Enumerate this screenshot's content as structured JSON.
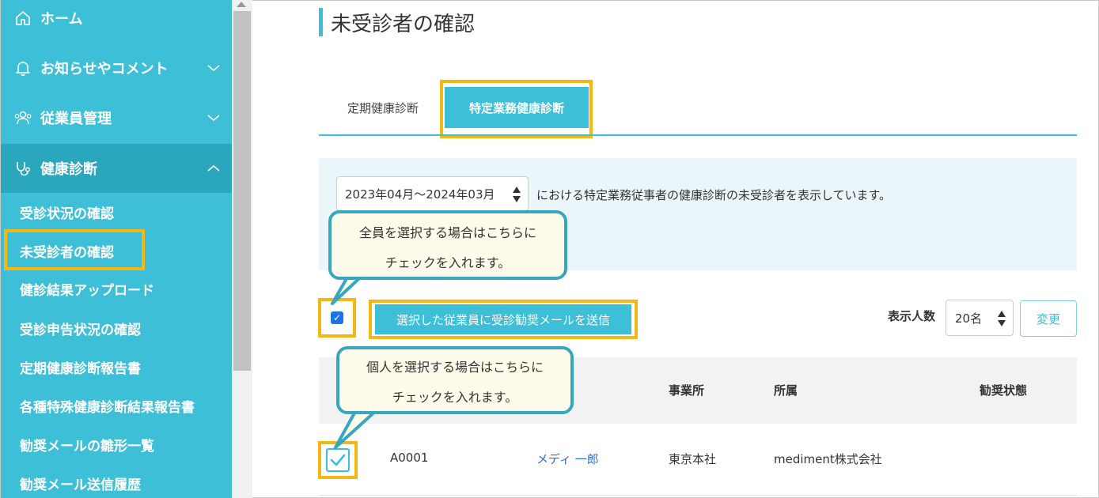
{
  "sidebar": {
    "items": [
      {
        "label": "ホーム",
        "icon": "home-icon"
      },
      {
        "label": "お知らせやコメント",
        "icon": "bell-icon"
      },
      {
        "label": "従業員管理",
        "icon": "users-icon"
      },
      {
        "label": "健康診断",
        "icon": "stethoscope-icon"
      }
    ],
    "subitems": [
      "受診状況の確認",
      "未受診者の確認",
      "健診結果アップロード",
      "受診申告状況の確認",
      "定期健康診断報告書",
      "各種特殊健康診断結果報告書",
      "勧奨メールの雛形一覧",
      "勧奨メール送信履歴"
    ]
  },
  "page": {
    "title": "未受診者の確認",
    "tabs": [
      "定期健康診断",
      "特定業務健康診断"
    ],
    "period": "2023年04月～2024年03月",
    "info_text": "における特定業務従事者の健康診断の未受診者を表示しています。",
    "send_button": "選択した従業員に受診勧奨メールを送信",
    "per_page_label": "表示人数",
    "per_page_value": "20名",
    "change_button": "変更",
    "columns": [
      "事業所",
      "所属",
      "勧奨状態"
    ],
    "rows": [
      {
        "id": "A0001",
        "name": "メディ 一郎",
        "office": "東京本社",
        "dept": "mediment株式会社"
      }
    ]
  },
  "callouts": {
    "select_all_line1": "全員を選択する場合はこちらに",
    "select_all_line2": "チェックを入れます。",
    "select_one_line1": "個人を選択する場合はこちらに",
    "select_one_line2": "チェックを入れます。"
  },
  "colors": {
    "primary": "#3ebfd8",
    "highlight": "#f5b812",
    "callout_bg": "#fffbea",
    "link": "#2f6fd0"
  }
}
